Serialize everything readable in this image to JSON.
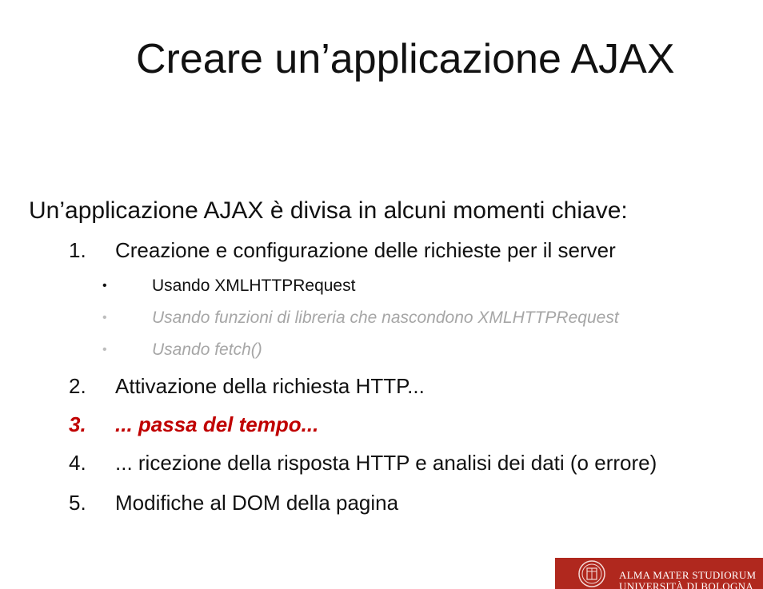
{
  "slide": {
    "title": "Creare un’applicazione AJAX",
    "intro": "Un’applicazione AJAX è divisa in alcuni momenti chiave:",
    "steps": [
      {
        "num": "1.",
        "text": "Creazione e configurazione delle richieste per il server"
      },
      {
        "num": "2.",
        "text": "Attivazione della richiesta HTTP..."
      },
      {
        "num": "3.",
        "text": "... passa del tempo..."
      },
      {
        "num": "4.",
        "text": "... ricezione della risposta HTTP e analisi dei dati (o errore)"
      },
      {
        "num": "5.",
        "text": "Modifiche al DOM della pagina"
      }
    ],
    "substeps": [
      {
        "bullet": "•",
        "text": "Usando XMLHTTPRequest"
      },
      {
        "bullet": "•",
        "text": "Usando funzioni di libreria che nascondono XMLHTTPRequest"
      },
      {
        "bullet": "•",
        "text": "Usando fetch()"
      }
    ],
    "highlight_color": "#c00000"
  },
  "logo": {
    "line1": "ALMA MATER STUDIORUM",
    "line2": "UNIVERSITÀ DI BOLOGNA",
    "background": "#b0281e",
    "icon": "university-seal-icon"
  }
}
